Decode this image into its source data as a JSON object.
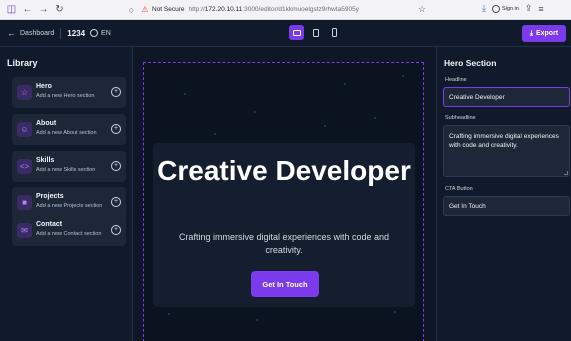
{
  "browser": {
    "not_secure": "Not Secure",
    "url_prefix": "http://",
    "url_host": "172.20.10.11",
    "url_path": ":3000/editor/d1kkmuoelgstz9rhwta5905y",
    "sign_in": "Sign in"
  },
  "header": {
    "back_label": "Dashboard",
    "project_id": "1234",
    "language": "EN",
    "export_label": "Export"
  },
  "library": {
    "title": "Library",
    "items": [
      {
        "name": "Hero",
        "desc": "Add a new Hero section",
        "icon": "hero-icon"
      },
      {
        "name": "About",
        "desc": "Add a new About section",
        "icon": "about-icon"
      },
      {
        "name": "Skills",
        "desc": "Add a new Skills section",
        "icon": "skills-icon"
      },
      {
        "name": "Projects",
        "desc": "Add a new Projects section",
        "icon": "projects-icon"
      },
      {
        "name": "Contact",
        "desc": "Add a new Contact section",
        "icon": "contact-icon"
      }
    ]
  },
  "preview": {
    "headline": "Creative Developer",
    "subheadline": "Crafting immersive digital experiences with code and creativity.",
    "cta": "Get In Touch"
  },
  "props": {
    "title": "Hero Section",
    "headline_label": "Headline",
    "headline_value": "Creative Developer",
    "subheadline_label": "Subheadline",
    "subheadline_value": "Crafting immersive digital experiences with code and creativity.",
    "cta_label": "CTA Button",
    "cta_value": "Get In Touch"
  },
  "colors": {
    "accent": "#7c3aed",
    "background": "#0d1422",
    "panel": "#111a2b"
  }
}
